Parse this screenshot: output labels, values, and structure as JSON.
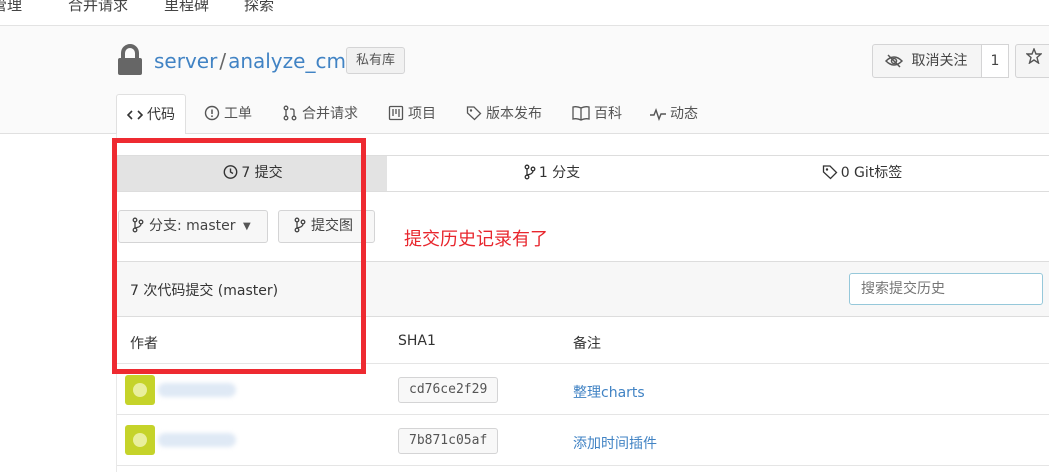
{
  "topnav": {
    "items": [
      "管理",
      "合并请求",
      "里程碑",
      "探索"
    ]
  },
  "repo": {
    "owner": "server",
    "separator": "/",
    "name": "analyze_cms",
    "visibility": "私有库"
  },
  "actions": {
    "unwatch_label": "取消关注",
    "watch_count": "1"
  },
  "tabs": [
    {
      "label": "代码",
      "icon": "code-icon"
    },
    {
      "label": "工单",
      "icon": "issue-icon"
    },
    {
      "label": "合并请求",
      "icon": "pull-request-icon"
    },
    {
      "label": "项目",
      "icon": "project-icon"
    },
    {
      "label": "版本发布",
      "icon": "tag-icon"
    },
    {
      "label": "百科",
      "icon": "book-icon"
    },
    {
      "label": "动态",
      "icon": "pulse-icon"
    }
  ],
  "stats": {
    "commits": "7 提交",
    "branches": "1 分支",
    "tags": "0 Git标签"
  },
  "toolbar": {
    "branch_label": "分支: master",
    "graph_label": "提交图"
  },
  "annotation": "提交历史记录有了",
  "commits_header": {
    "count_text": "7 次代码提交 (master)",
    "search_placeholder": "搜索提交历史"
  },
  "table": {
    "columns": [
      "作者",
      "SHA1",
      "备注"
    ],
    "rows": [
      {
        "sha": "cd76ce2f29",
        "message": "整理charts"
      },
      {
        "sha": "7b871c05af",
        "message": "添加时间插件"
      }
    ]
  },
  "colors": {
    "link": "#4183c4",
    "annotation": "#e8262d",
    "highlight_box": "#ee2a31"
  }
}
